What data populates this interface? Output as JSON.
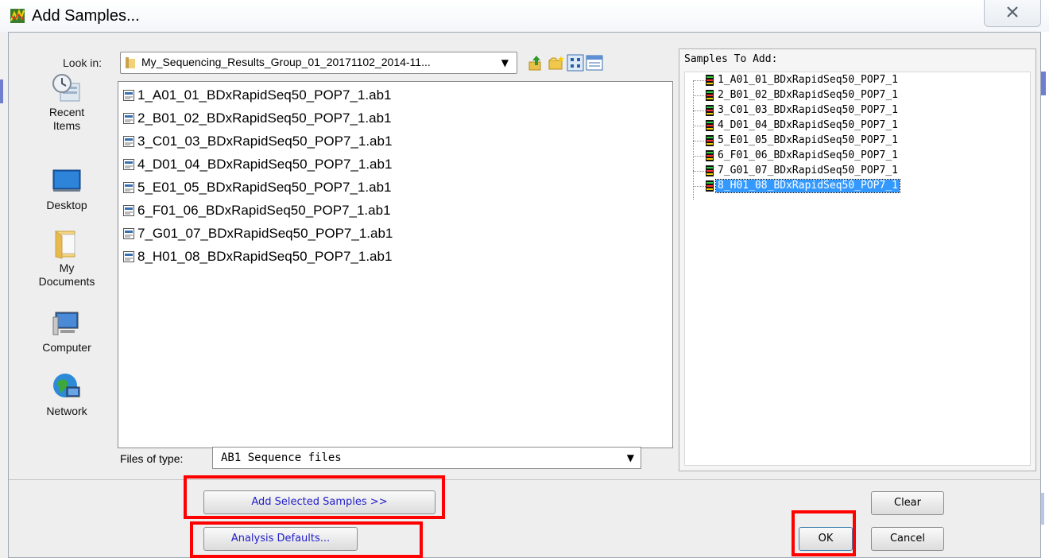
{
  "window": {
    "title": "Add Samples...",
    "close_icon": "close-x-icon"
  },
  "lookin": {
    "label": "Look in:",
    "value": "My_Sequencing_Results_Group_01_20171102_2014-11..."
  },
  "places": [
    {
      "label_line1": "Recent",
      "label_line2": "Items",
      "icon": "recent-items-icon"
    },
    {
      "label_line1": "Desktop",
      "label_line2": "",
      "icon": "desktop-icon"
    },
    {
      "label_line1": "My",
      "label_line2": "Documents",
      "icon": "my-documents-icon"
    },
    {
      "label_line1": "Computer",
      "label_line2": "",
      "icon": "computer-icon"
    },
    {
      "label_line1": "Network",
      "label_line2": "",
      "icon": "network-icon"
    }
  ],
  "files": [
    "1_A01_01_BDxRapidSeq50_POP7_1.ab1",
    "2_B01_02_BDxRapidSeq50_POP7_1.ab1",
    "3_C01_03_BDxRapidSeq50_POP7_1.ab1",
    "4_D01_04_BDxRapidSeq50_POP7_1.ab1",
    "5_E01_05_BDxRapidSeq50_POP7_1.ab1",
    "6_F01_06_BDxRapidSeq50_POP7_1.ab1",
    "7_G01_07_BDxRapidSeq50_POP7_1.ab1",
    "8_H01_08_BDxRapidSeq50_POP7_1.ab1"
  ],
  "filetype": {
    "label": "Files of type:",
    "value": "AB1 Sequence files"
  },
  "samples": {
    "title": "Samples To Add:",
    "items": [
      "1_A01_01_BDxRapidSeq50_POP7_1",
      "2_B01_02_BDxRapidSeq50_POP7_1",
      "3_C01_03_BDxRapidSeq50_POP7_1",
      "4_D01_04_BDxRapidSeq50_POP7_1",
      "5_E01_05_BDxRapidSeq50_POP7_1",
      "6_F01_06_BDxRapidSeq50_POP7_1",
      "7_G01_07_BDxRapidSeq50_POP7_1",
      "8_H01_08_BDxRapidSeq50_POP7_1"
    ],
    "selected_index": 7
  },
  "buttons": {
    "add_selected": "Add Selected Samples >>",
    "analysis_defaults": "Analysis Defaults...",
    "clear": "Clear",
    "ok": "OK",
    "cancel": "Cancel"
  },
  "colors": {
    "highlight_box": "#ff0000",
    "selection": "#3399ff",
    "button_text_blue": "#2320c8"
  }
}
